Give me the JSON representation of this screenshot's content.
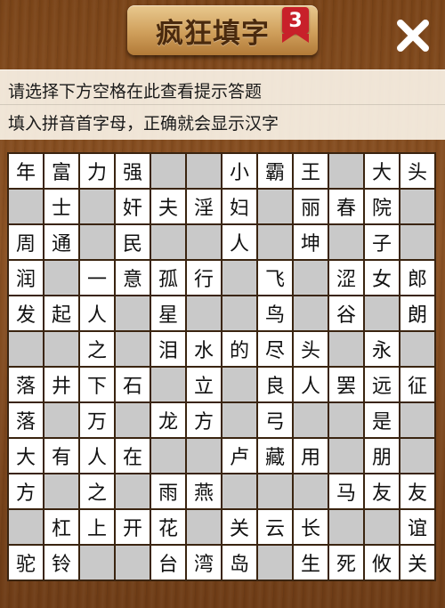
{
  "header": {
    "title": "疯狂填字",
    "level": "3"
  },
  "hints": {
    "line1": "请选择下方空格在此查看提示答题",
    "line2": "填入拼音首字母，正确就会显示汉字"
  },
  "icons": {
    "close": "close-icon"
  },
  "colors": {
    "wood": "#7a4418",
    "badge": "#c8202a",
    "grid_line": "#3a2410",
    "empty_cell": "#c9c9c9"
  },
  "grid": [
    [
      "年",
      "富",
      "力",
      "强",
      "",
      "",
      "小",
      "霸",
      "王",
      "",
      "大",
      "头"
    ],
    [
      "",
      "士",
      "",
      "奸",
      "夫",
      "淫",
      "妇",
      "",
      "丽",
      "春",
      "院",
      ""
    ],
    [
      "周",
      "通",
      "",
      "民",
      "",
      "",
      "人",
      "",
      "坤",
      "",
      "子",
      ""
    ],
    [
      "润",
      "",
      "一",
      "意",
      "孤",
      "行",
      "",
      "飞",
      "",
      "涩",
      "女",
      "郎"
    ],
    [
      "发",
      "起",
      "人",
      "",
      "星",
      "",
      "",
      "鸟",
      "",
      "谷",
      "",
      "朗"
    ],
    [
      "",
      "",
      "之",
      "",
      "泪",
      "水",
      "的",
      "尽",
      "头",
      "",
      "永",
      ""
    ],
    [
      "落",
      "井",
      "下",
      "石",
      "",
      "立",
      "",
      "良",
      "人",
      "罢",
      "远",
      "征"
    ],
    [
      "落",
      "",
      "万",
      "",
      "龙",
      "方",
      "",
      "弓",
      "",
      "",
      "是",
      ""
    ],
    [
      "大",
      "有",
      "人",
      "在",
      "",
      "",
      "卢",
      "藏",
      "用",
      "",
      "朋",
      ""
    ],
    [
      "方",
      "",
      "之",
      "",
      "雨",
      "燕",
      "",
      "",
      "",
      "马",
      "友",
      "友"
    ],
    [
      "",
      "杠",
      "上",
      "开",
      "花",
      "",
      "关",
      "云",
      "长",
      "",
      "",
      "谊"
    ],
    [
      "驼",
      "铃",
      "",
      "",
      "台",
      "湾",
      "岛",
      "",
      "生",
      "死",
      "攸",
      "关"
    ]
  ]
}
